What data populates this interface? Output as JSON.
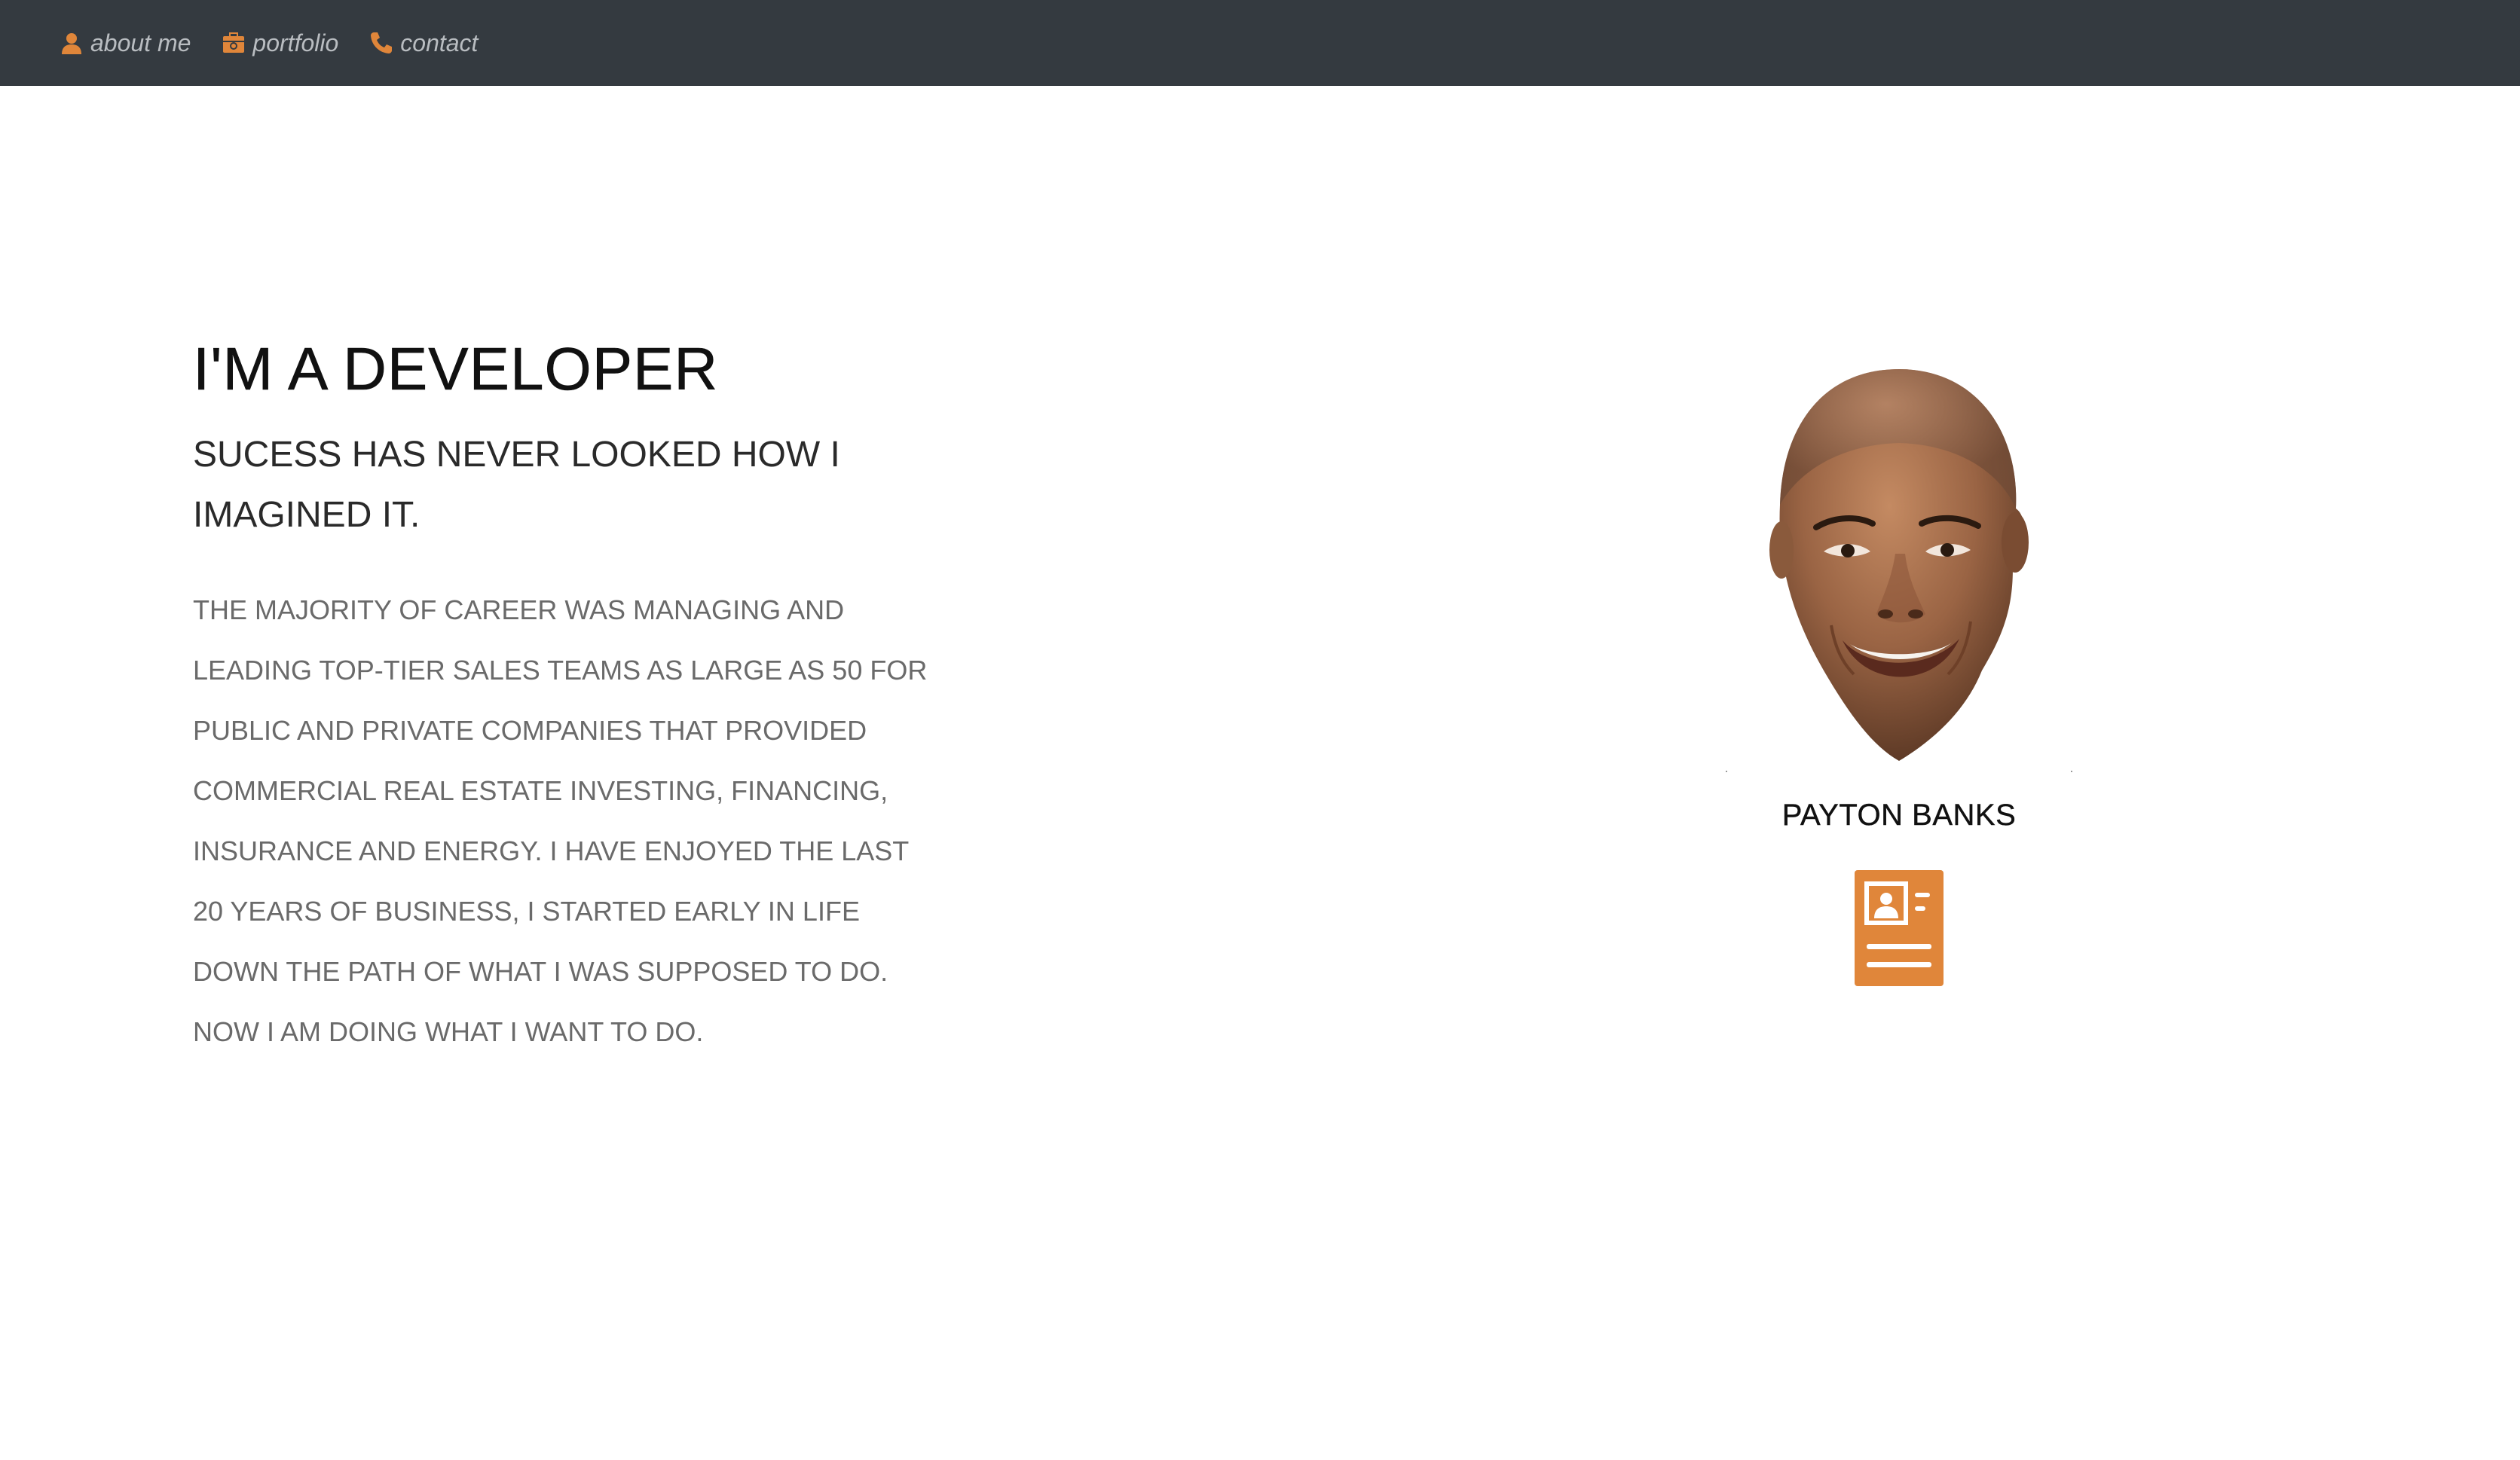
{
  "nav": {
    "items": [
      {
        "label": "about me",
        "icon": "person-icon"
      },
      {
        "label": "portfolio",
        "icon": "briefcase-icon"
      },
      {
        "label": "contact",
        "icon": "phone-icon"
      }
    ]
  },
  "hero": {
    "headline": "I'M A DEVELOPER",
    "subhead": "SUCESS HAS NEVER LOOKED HOW I IMAGINED IT.",
    "body": "THE MAJORITY OF CAREER WAS MANAGING AND LEADING TOP-TIER SALES TEAMS AS LARGE AS 50 FOR PUBLIC AND PRIVATE COMPANIES THAT PROVIDED COMMERCIAL REAL ESTATE INVESTING, FINANCING, INSURANCE AND ENERGY. I HAVE ENJOYED THE LAST 20 YEARS OF BUSINESS, I STARTED EARLY IN LIFE DOWN THE PATH OF WHAT I WAS SUPPOSED TO DO. NOW I AM DOING WHAT I WANT TO DO."
  },
  "profile": {
    "name": "PAYTON BANKS",
    "resume_icon": "id-card-icon"
  },
  "colors": {
    "navbar_bg": "#343a40",
    "accent": "#e0863a",
    "nav_text": "#b9bdc1"
  }
}
